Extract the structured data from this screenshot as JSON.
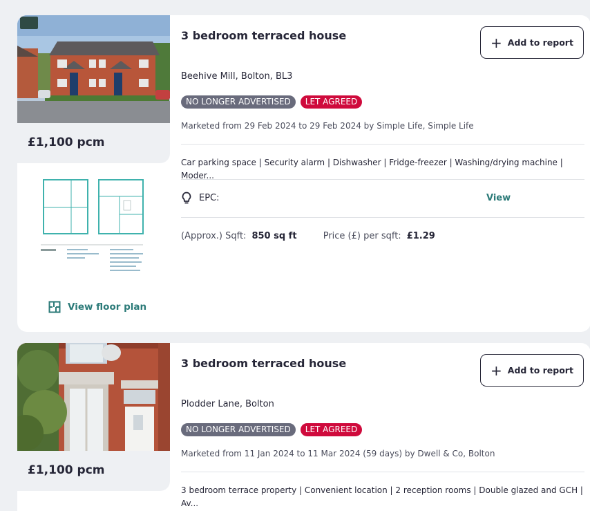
{
  "listings": [
    {
      "title": "3 bedroom terraced house",
      "address": "Beehive Mill, Bolton, BL3",
      "price": "£1,100 pcm",
      "badges": [
        "NO LONGER ADVERTISED",
        "LET AGREED"
      ],
      "marketed": "Marketed from 29 Feb 2024 to 29 Feb 2024 by Simple Life, Simple Life",
      "features": "Car parking space | Security alarm | Dishwasher | Fridge-freezer | Washing/drying machine | Moder...",
      "add_label": "Add to report",
      "epc_label": "EPC:",
      "epc_link": "View",
      "sqft_label": "(Approx.) Sqft:",
      "sqft_value": "850 sq ft",
      "ppsf_label": "Price (£) per sqft:",
      "ppsf_value": "£1.29",
      "floor_plan_label": "View floor plan",
      "photo_icon": "terraced-houses-photo"
    },
    {
      "title": "3 bedroom terraced house",
      "address": "Plodder Lane, Bolton",
      "price": "£1,100 pcm",
      "badges": [
        "NO LONGER ADVERTISED",
        "LET AGREED"
      ],
      "marketed": "Marketed from 11 Jan 2024 to 11 Mar 2024 (59 days) by Dwell & Co, Bolton",
      "features": "3 bedroom terrace property | Convenient location | 2 reception rooms | Double glazed and GCH | Av...",
      "add_label": "Add to report",
      "photo_icon": "brick-house-photo"
    }
  ],
  "colors": {
    "accent": "#2b7a78",
    "badge_grey": "#696b7c",
    "badge_red": "#cf0a3c",
    "text": "#262637"
  }
}
